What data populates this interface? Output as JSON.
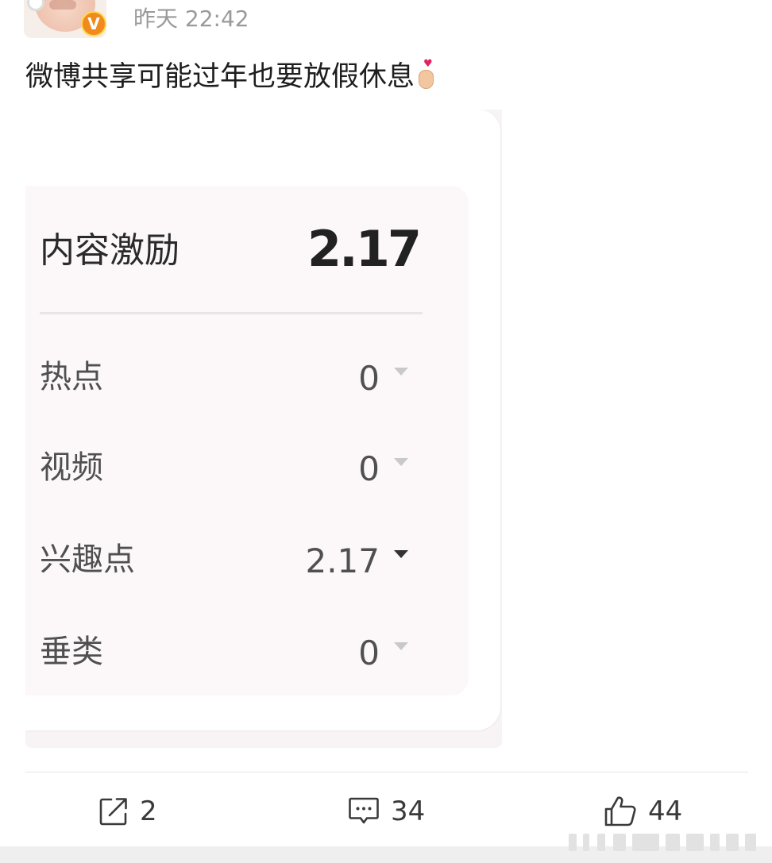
{
  "post": {
    "time": "昨天 22:42",
    "text": "微博共享可能过年也要放假休息",
    "emoji_icon": "finger-heart-icon",
    "verified_badge": "V"
  },
  "income_card": {
    "title": "内容激励",
    "total": "2.17",
    "rows": [
      {
        "label": "热点",
        "value": "0",
        "active": false
      },
      {
        "label": "视频",
        "value": "0",
        "active": false
      },
      {
        "label": "兴趣点",
        "value": "2.17",
        "active": true
      },
      {
        "label": "垂类",
        "value": "0",
        "active": false
      }
    ]
  },
  "actions": {
    "repost_count": "2",
    "comment_count": "34",
    "like_count": "44",
    "repost_icon": "share-icon",
    "comment_icon": "comment-icon",
    "like_icon": "thumbs-up-icon"
  },
  "colors": {
    "panel_bg": "#fcf8fa",
    "badge_orange": "#f08a1d",
    "badge_border": "#ffd84a",
    "time_gray": "#9a9a9a",
    "caret_active": "#333333",
    "caret_inactive": "#c9c9c9"
  }
}
